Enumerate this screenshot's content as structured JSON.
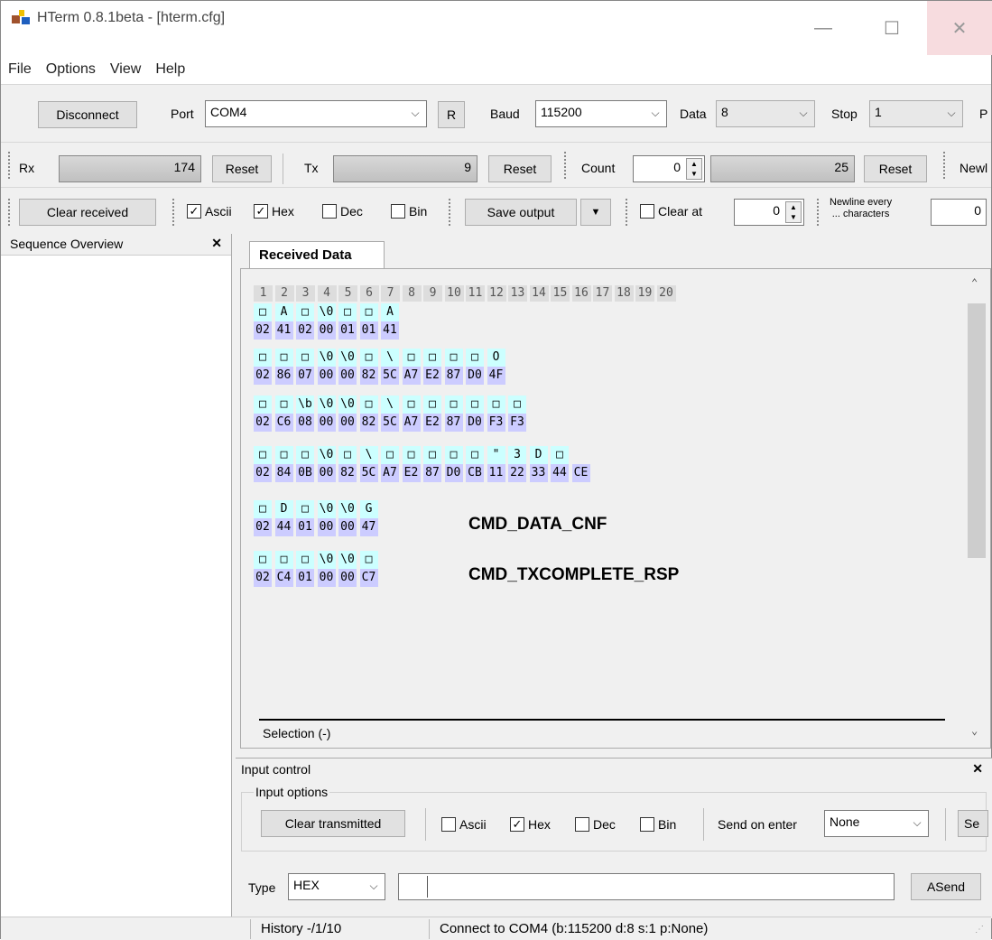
{
  "window": {
    "title": "HTerm 0.8.1beta - [hterm.cfg]",
    "minimize": "—",
    "maximize": "☐",
    "close": "✕"
  },
  "menu": [
    "File",
    "Options",
    "View",
    "Help"
  ],
  "toolbar1": {
    "disconnect": "Disconnect",
    "port_label": "Port",
    "port_value": "COM4",
    "r_button": "R",
    "baud_label": "Baud",
    "baud_value": "115200",
    "data_label": "Data",
    "data_value": "8",
    "stop_label": "Stop",
    "stop_value": "1",
    "parity_label": "P"
  },
  "toolbar2": {
    "rx_label": "Rx",
    "rx_value": "174",
    "rx_reset": "Reset",
    "tx_label": "Tx",
    "tx_value": "9",
    "tx_reset": "Reset",
    "count_label": "Count",
    "count_value": "0",
    "count_bar": "25",
    "count_reset": "Reset",
    "newline_label": "Newl"
  },
  "toolbar3": {
    "clear_received": "Clear received",
    "ascii": "Ascii",
    "hex": "Hex",
    "dec": "Dec",
    "bin": "Bin",
    "save_output": "Save output",
    "clear_at": "Clear at",
    "clear_at_value": "0",
    "newline_every": "Newline every",
    "newline_chars": "... characters",
    "newline_value": "0"
  },
  "sequence_overview": {
    "title": "Sequence Overview",
    "close": "✕"
  },
  "received": {
    "tab": "Received Data",
    "columns": [
      "1",
      "2",
      "3",
      "4",
      "5",
      "6",
      "7",
      "8",
      "9",
      "10",
      "11",
      "12",
      "13",
      "14",
      "15",
      "16",
      "17",
      "18",
      "19",
      "20"
    ],
    "rows": [
      {
        "ascii": [
          "□",
          "A",
          "□",
          "\\0",
          "□",
          "□",
          "A"
        ],
        "hex": [
          "02",
          "41",
          "02",
          "00",
          "01",
          "01",
          "41"
        ]
      },
      {
        "ascii": [
          "□",
          "□",
          "□",
          "\\0",
          "\\0",
          "□",
          "\\",
          "□",
          "□",
          "□",
          "□",
          "O"
        ],
        "hex": [
          "02",
          "86",
          "07",
          "00",
          "00",
          "82",
          "5C",
          "A7",
          "E2",
          "87",
          "D0",
          "4F"
        ]
      },
      {
        "ascii": [
          "□",
          "□",
          "\\b",
          "\\0",
          "\\0",
          "□",
          "\\",
          "□",
          "□",
          "□",
          "□",
          "□",
          "□"
        ],
        "hex": [
          "02",
          "C6",
          "08",
          "00",
          "00",
          "82",
          "5C",
          "A7",
          "E2",
          "87",
          "D0",
          "F3",
          "F3"
        ]
      },
      {
        "ascii": [
          "□",
          "□",
          "□",
          "\\0",
          "□",
          "\\",
          "□",
          "□",
          "□",
          "□",
          "□",
          "\"",
          "3",
          "D",
          "□"
        ],
        "hex": [
          "02",
          "84",
          "0B",
          "00",
          "82",
          "5C",
          "A7",
          "E2",
          "87",
          "D0",
          "CB",
          "11",
          "22",
          "33",
          "44",
          "CE"
        ]
      },
      {
        "ascii": [
          "□",
          "D",
          "□",
          "\\0",
          "\\0",
          "G"
        ],
        "hex": [
          "02",
          "44",
          "01",
          "00",
          "00",
          "47"
        ],
        "note": "CMD_DATA_CNF"
      },
      {
        "ascii": [
          "□",
          "□",
          "□",
          "\\0",
          "\\0",
          "□"
        ],
        "hex": [
          "02",
          "C4",
          "01",
          "00",
          "00",
          "C7"
        ],
        "note": "CMD_TXCOMPLETE_RSP"
      }
    ],
    "selection": "Selection (-)"
  },
  "input": {
    "title": "Input control",
    "close": "✕",
    "options_label": "Input options",
    "clear_transmitted": "Clear transmitted",
    "ascii": "Ascii",
    "hex": "Hex",
    "dec": "Dec",
    "bin": "Bin",
    "send_on_enter": "Send on enter",
    "send_on_enter_value": "None",
    "send_label": "Se",
    "type_label": "Type",
    "type_value": "HEX",
    "asend": "ASend"
  },
  "status": {
    "history": "History -/1/10",
    "connection": "Connect to COM4 (b:115200 d:8 s:1 p:None)"
  }
}
